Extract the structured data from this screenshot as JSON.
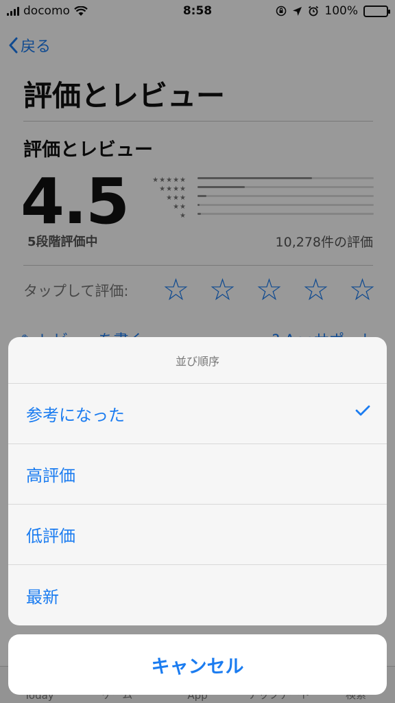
{
  "status": {
    "carrier": "docomo",
    "time": "8:58",
    "battery": "100%"
  },
  "nav": {
    "back_label": "戻る"
  },
  "page": {
    "title": "評価とレビュー",
    "section_title": "評価とレビュー",
    "rating": "4.5",
    "out_of": "5段階評価中",
    "rating_count": "10,278件の評価",
    "star_rows": [
      "★★★★★",
      "★★★★",
      "★★★",
      "★★",
      "★"
    ],
    "distribution": [
      0.65,
      0.27,
      0.05,
      0.01,
      0.02
    ],
    "tap_label": "タップして評価:",
    "tap_star": "☆",
    "write_review": "レビューを書く",
    "support": "Appサポート"
  },
  "tabbar": {
    "tabs": [
      "Today",
      "ゲーム",
      "App",
      "アップデート",
      "検索"
    ]
  },
  "sheet": {
    "title": "並び順序",
    "options": [
      {
        "label": "参考になった",
        "selected": true
      },
      {
        "label": "高評価",
        "selected": false
      },
      {
        "label": "低評価",
        "selected": false
      },
      {
        "label": "最新",
        "selected": false
      }
    ],
    "cancel_label": "キャンセル"
  },
  "colors": {
    "accent": "#1b7cf0",
    "sheet_bg": "#f6f6f6",
    "dim": "rgba(0,0,0,0.4)"
  }
}
